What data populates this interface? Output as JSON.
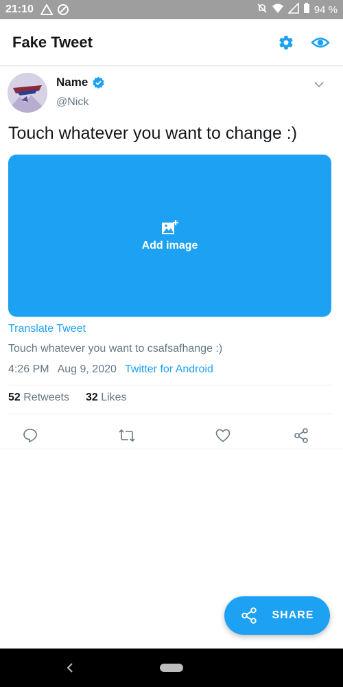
{
  "status_bar": {
    "time": "21:10",
    "battery": "94 %"
  },
  "app_bar": {
    "title": "Fake Tweet",
    "settings_icon": "gear-icon",
    "preview_icon": "eye-icon"
  },
  "tweet": {
    "name": "Name",
    "handle": "@Nick",
    "text": "Touch whatever you want to change :)",
    "image_label": "Add image",
    "translate_label": "Translate Tweet",
    "translated_text": "Touch whatever you want to csafsafhange :)",
    "time": "4:26 PM",
    "date": "Aug 9, 2020",
    "source": "Twitter for Android",
    "retweets_count": "52",
    "retweets_label": "Retweets",
    "likes_count": "32",
    "likes_label": "Likes"
  },
  "fab": {
    "label": "SHARE"
  },
  "colors": {
    "accent": "#1da1f2",
    "status_bar": "#9e9e9e",
    "text_secondary": "#657786"
  }
}
